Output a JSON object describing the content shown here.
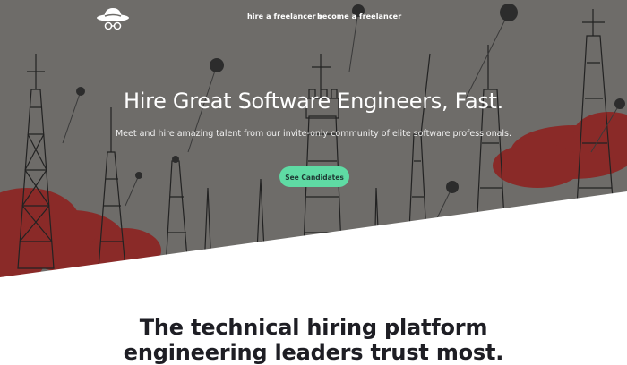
{
  "header": {
    "logo": "cowboy-hat-glasses-logo",
    "nav": [
      {
        "label": "hire a freelancer",
        "has_dropdown": true,
        "caret_icon": "chevron-down-icon"
      },
      {
        "label": "become a freelancer",
        "has_dropdown": false
      }
    ]
  },
  "hero": {
    "title": "Hire Great Software Engineers, Fast.",
    "subtitle": "Meet and hire amazing talent from our invite-only community of elite software professionals.",
    "cta_label": "See Candidates",
    "background_illustration": "radio-towers-with-falling-balls"
  },
  "section": {
    "title_line1": "The technical hiring platform",
    "title_line2": "engineering leaders trust most."
  },
  "colors": {
    "hero_bg": "#6e6c69",
    "hero_red": "#8a2a28",
    "cta": "#5fdba4",
    "heading": "#1e1e24"
  }
}
